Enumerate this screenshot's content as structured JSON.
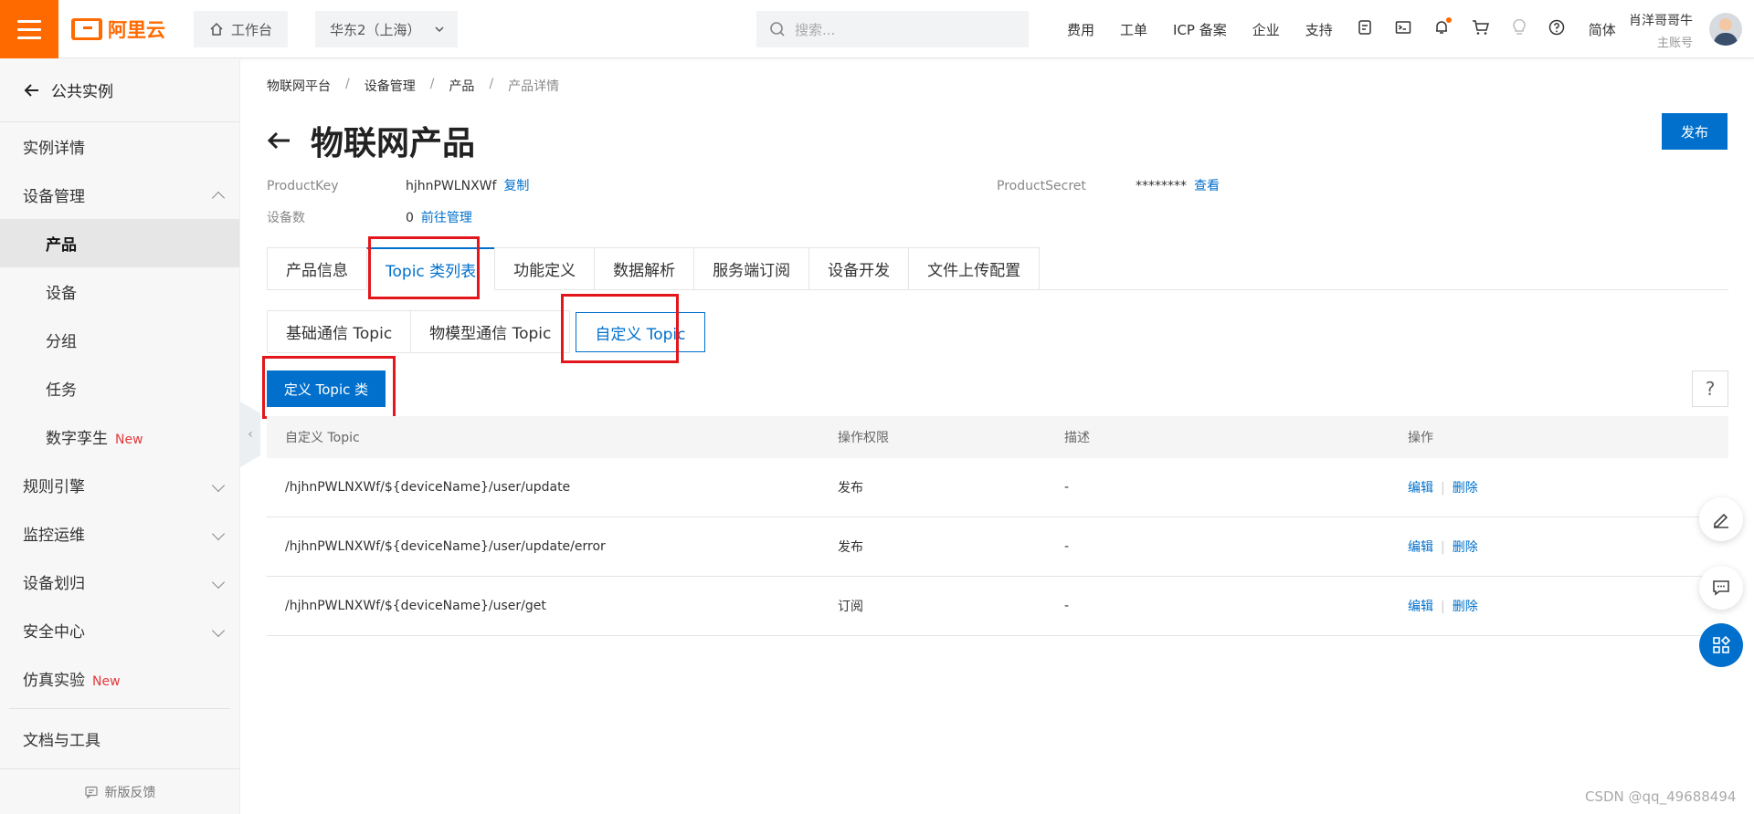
{
  "header": {
    "logo_text": "阿里云",
    "workspace": "工作台",
    "region": "华东2（上海）",
    "search_placeholder": "搜索...",
    "nav": [
      "费用",
      "工单",
      "ICP 备案",
      "企业",
      "支持"
    ],
    "lang": "简体",
    "user_name": "肖洋哥哥牛",
    "user_role": "主账号"
  },
  "sidebar": {
    "back": "公共实例",
    "items": [
      {
        "label": "实例详情"
      },
      {
        "label": "设备管理"
      },
      {
        "label": "产品"
      },
      {
        "label": "设备"
      },
      {
        "label": "分组"
      },
      {
        "label": "任务"
      },
      {
        "label": "数字孪生",
        "badge": "New"
      },
      {
        "label": "规则引擎"
      },
      {
        "label": "监控运维"
      },
      {
        "label": "设备划归"
      },
      {
        "label": "安全中心"
      },
      {
        "label": "仿真实验",
        "badge": "New"
      },
      {
        "label": "文档与工具"
      }
    ],
    "feedback": "新版反馈"
  },
  "breadcrumb": [
    "物联网平台",
    "设备管理",
    "产品",
    "产品详情"
  ],
  "page": {
    "title": "物联网产品",
    "publish": "发布",
    "product_key_label": "ProductKey",
    "product_key": "hjhnPWLNXWf",
    "copy": "复制",
    "product_secret_label": "ProductSecret",
    "product_secret": "********",
    "view": "查看",
    "device_count_label": "设备数",
    "device_count": "0",
    "manage": "前往管理"
  },
  "tabs": [
    "产品信息",
    "Topic 类列表",
    "功能定义",
    "数据解析",
    "服务端订阅",
    "设备开发",
    "文件上传配置"
  ],
  "subtabs": [
    "基础通信 Topic",
    "物模型通信 Topic",
    "自定义 Topic"
  ],
  "define_button": "定义 Topic 类",
  "help": "?",
  "table": {
    "headers": [
      "自定义 Topic",
      "操作权限",
      "描述",
      "操作"
    ],
    "rows": [
      {
        "topic": "/hjhnPWLNXWf/${deviceName}/user/update",
        "perm": "发布",
        "desc": "-",
        "edit": "编辑",
        "del": "删除"
      },
      {
        "topic": "/hjhnPWLNXWf/${deviceName}/user/update/error",
        "perm": "发布",
        "desc": "-",
        "edit": "编辑",
        "del": "删除"
      },
      {
        "topic": "/hjhnPWLNXWf/${deviceName}/user/get",
        "perm": "订阅",
        "desc": "-",
        "edit": "编辑",
        "del": "删除"
      }
    ]
  },
  "watermark": "CSDN @qq_49688494",
  "colors": {
    "brand": "#ff6a00",
    "primary": "#0070cc",
    "highlight": "#e3171b",
    "new_badge": "#e4393c"
  }
}
